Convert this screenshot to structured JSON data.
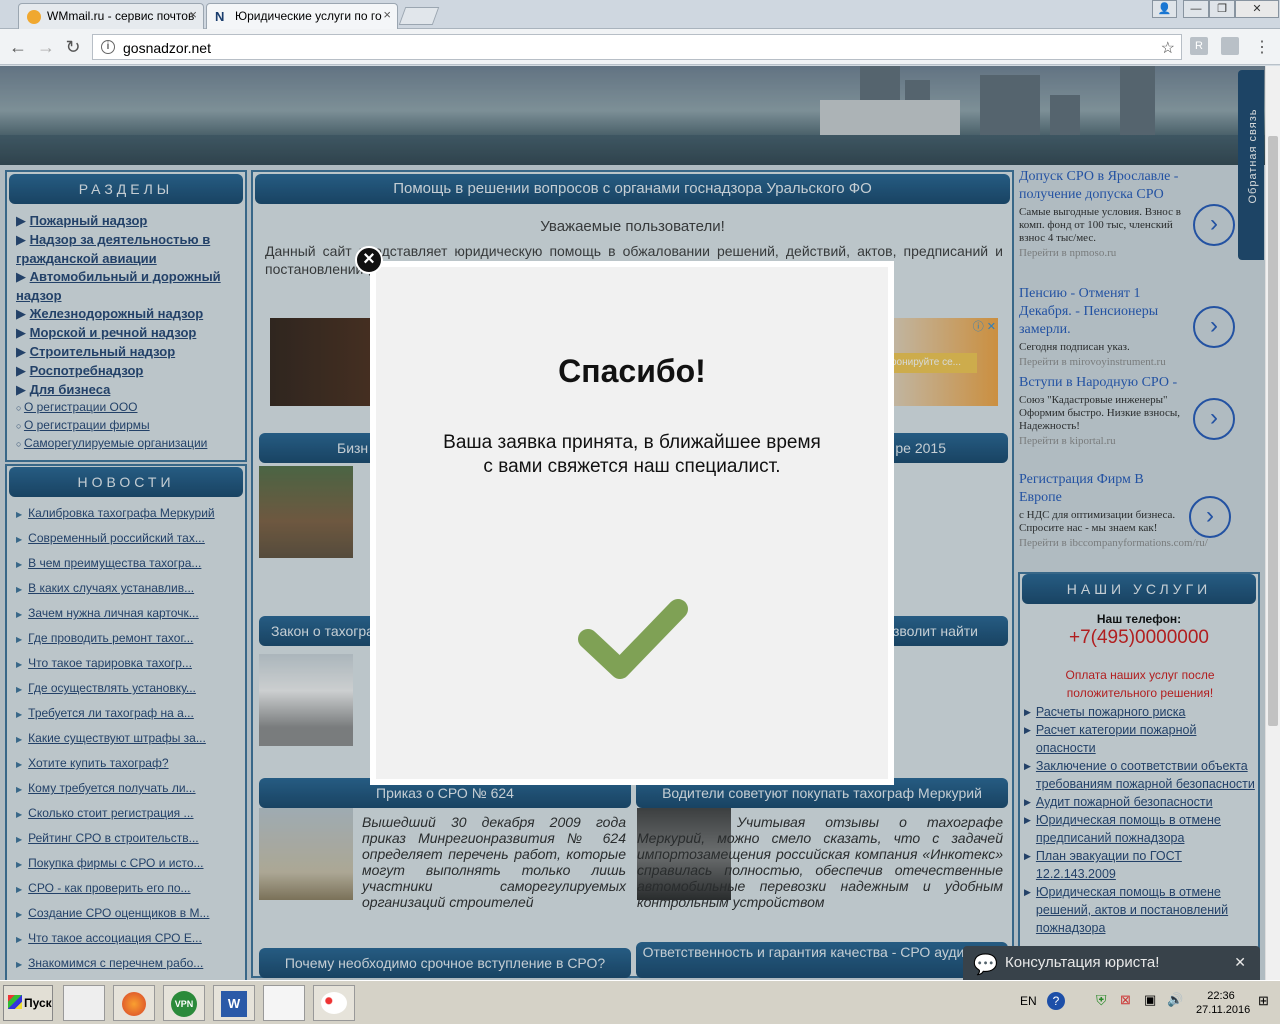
{
  "browser": {
    "tabs": [
      {
        "label": "WMmail.ru - сервис почтов",
        "active": false
      },
      {
        "label": "Юридические услуги по го",
        "active": true
      }
    ],
    "url": "gosnadzor.net",
    "window_buttons": [
      "—",
      "❐",
      "✕"
    ]
  },
  "sidebar": {
    "sections_header": "РАЗДЕЛЫ",
    "sections": [
      "Пожарный надзор",
      "Надзор за деятельностью в гражданской авиации",
      "Автомобильный и дорожный надзор",
      "Железнодорожный надзор",
      "Морской и речной надзор",
      "Строительный надзор",
      "Роспотребнадзор",
      "Для бизнеса"
    ],
    "subsections": [
      "О регистрации ООО",
      "О регистрации фирмы",
      "Саморегулируемые организации"
    ],
    "news_header": "НОВОСТИ",
    "news": [
      "Калибровка тахографа Меркурий",
      "Современный российский тах...",
      "В чем преимущества тахогра...",
      "В каких случаях устанавлив...",
      "Зачем нужна личная карточк...",
      "Где проводить ремонт тахог...",
      "Что такое тарировка тахогр...",
      "Где осуществлять установку...",
      "Требуется ли тахограф на а...",
      "Какие существуют штрафы за...",
      "Хотите купить тахограф?",
      "Кому требуется получать ли...",
      "Сколько стоит регистрация ...",
      "Рейтинг СРО в строительств...",
      "Покупка фирмы с СРО и исто...",
      "СРО - как проверить его по...",
      "Создание СРО оценщиков в М...",
      "Что такое ассоциация СРО Е...",
      "Знакомимся с перечнем рабо..."
    ]
  },
  "main": {
    "header": "Помощь в решении вопросов с органами госнадзора Уральского ФО",
    "greeting": "Уважаемые пользователи!",
    "intro": "Данный сайт представляет юридическую помощь в обжаловании решений, действий, актов, предписаний и постановлений (арного надзора), установление и",
    "article_headers": [
      "Бизн",
      "ре 2015",
      "Закон о тахогра",
      "зволит найти",
      "Приказ о СРО № 624",
      "Водители советуют покупать тахограф Меркурий",
      "Почему необходимо срочное вступление в СРО?",
      "Ответственность и гарантия качества - СРО аудиторов"
    ],
    "article1": "Вышедший 30 декабря 2009 года приказ Минрегионразвития № 624 определяет перечень работ, которые могут выполнять только лишь участники саморегулируемых организаций строителей",
    "article2": "Учитывая отзывы о тахографе Меркурий, можно смело сказать, что с задачей импортозамещения российская компания «Инкотекс» справилась полностью, обеспечив отечественные автомобильные перевозки надежным и удобным контрольным устройством",
    "ad_button": "ронируйте се..."
  },
  "ads": [
    {
      "title": "Допуск СРО в Ярославле - получение допуска СРО",
      "desc": "Самые выгодные условия. Взнос в комп. фонд от 100 тыс, членский взнос 4 тыс/мес.",
      "link": "Перейти в npmoso.ru"
    },
    {
      "title": "Пенсию - Отменят 1 Декабря. - Пенсионеры замерли.",
      "desc": "Сегодня подписан указ.",
      "link": "Перейти в mirovoyinstrument.ru"
    },
    {
      "title": "Вступи в Народную СРО -",
      "desc": "Союз \"Кадастровые инженеры\" Оформим быстро. Низкие взносы, Надежность!",
      "link": "Перейти в kiportal.ru"
    },
    {
      "title": "Регистрация Фирм В Европе",
      "desc": "с НДС для оптимизации бизнеса. Спросите нас - мы знаем как!",
      "link": "Перейти в ibccompanyformations.com/ru/"
    }
  ],
  "services": {
    "header": "НАШИ УСЛУГИ",
    "phone_label": "Наш телефон:",
    "phone": "+7(495)0000000",
    "note": "Оплата наших услуг после положительного решения!",
    "items": [
      "Расчеты пожарного риска",
      "Расчет категории пожарной опасности",
      "Заключение о соответствии объекта требованиям пожарной безопасности",
      "Аудит пожарной безопасности",
      "Юридическая помощь в отмене предписаний пожнадзора",
      "План эвакуации по ГОСТ 12.2.143.2009",
      "Юридическая помощь в отмене решений, актов и постановлений пожнадзора"
    ]
  },
  "feedback_label": "Обратная связь",
  "chat_label": "Консультация юриста!",
  "modal": {
    "title": "Спасибо!",
    "message": "Ваша заявка принята, в ближайшее время с вами свяжется наш специалист.",
    "check_color": "#7fa155"
  },
  "taskbar": {
    "start_label": "Пуск",
    "lang": "EN",
    "time": "22:36",
    "date": "27.11.2016"
  }
}
